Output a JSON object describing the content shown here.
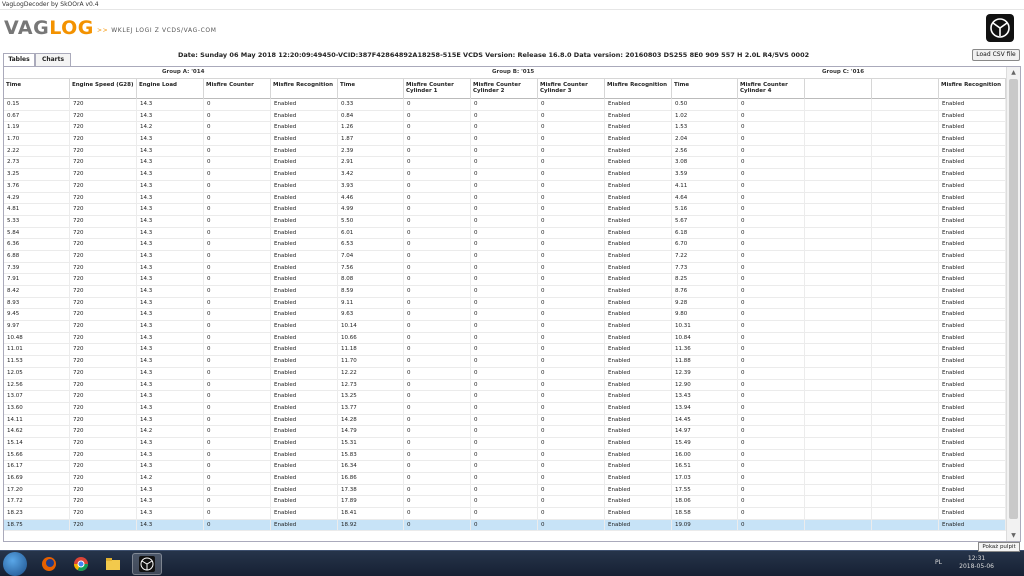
{
  "window": {
    "title": "VagLogDecoder by SkOOrA v0.4"
  },
  "logo": {
    "text_main": "VAG",
    "text_accent": "LOG",
    "arrows": ">>",
    "subtitle": "WKLEJ LOGI Z VCDS/VAG-COM"
  },
  "tabs": [
    {
      "label": "Tables",
      "active": true
    },
    {
      "label": "Charts",
      "active": false
    }
  ],
  "info": "Date: Sunday 06 May 2018 12:20:09:49450-VCID:387F42864892A18258-515E VCDS Version: Release 16.8.0 Data version: 20160803 DS255 8E0 909 557 H  2.0L R4/5VS       0002",
  "load_button": "Load CSV file",
  "groups": [
    "Group A: '014",
    "Group B: '015",
    "Group C: '016"
  ],
  "columns": [
    "Time",
    "Engine Speed (G28)",
    "Engine Load",
    "Misfire Counter",
    "Misfire Recognition",
    "Time",
    "Misfire Counter Cylinder 1",
    "Misfire Counter Cylinder 2",
    "Misfire Counter Cylinder 3",
    "Misfire Recognition",
    "Time",
    "Misfire Counter Cylinder 4",
    "",
    "",
    "Misfire Recognition"
  ],
  "rows": [
    [
      "0.15",
      "720",
      "14.3",
      "0",
      "Enabled",
      "0.33",
      "0",
      "0",
      "0",
      "Enabled",
      "0.50",
      "0",
      "",
      "",
      "Enabled"
    ],
    [
      "0.67",
      "720",
      "14.3",
      "0",
      "Enabled",
      "0.84",
      "0",
      "0",
      "0",
      "Enabled",
      "1.02",
      "0",
      "",
      "",
      "Enabled"
    ],
    [
      "1.19",
      "720",
      "14.2",
      "0",
      "Enabled",
      "1.26",
      "0",
      "0",
      "0",
      "Enabled",
      "1.53",
      "0",
      "",
      "",
      "Enabled"
    ],
    [
      "1.70",
      "720",
      "14.3",
      "0",
      "Enabled",
      "1.87",
      "0",
      "0",
      "0",
      "Enabled",
      "2.04",
      "0",
      "",
      "",
      "Enabled"
    ],
    [
      "2.22",
      "720",
      "14.3",
      "0",
      "Enabled",
      "2.39",
      "0",
      "0",
      "0",
      "Enabled",
      "2.56",
      "0",
      "",
      "",
      "Enabled"
    ],
    [
      "2.73",
      "720",
      "14.3",
      "0",
      "Enabled",
      "2.91",
      "0",
      "0",
      "0",
      "Enabled",
      "3.08",
      "0",
      "",
      "",
      "Enabled"
    ],
    [
      "3.25",
      "720",
      "14.3",
      "0",
      "Enabled",
      "3.42",
      "0",
      "0",
      "0",
      "Enabled",
      "3.59",
      "0",
      "",
      "",
      "Enabled"
    ],
    [
      "3.76",
      "720",
      "14.3",
      "0",
      "Enabled",
      "3.93",
      "0",
      "0",
      "0",
      "Enabled",
      "4.11",
      "0",
      "",
      "",
      "Enabled"
    ],
    [
      "4.29",
      "720",
      "14.3",
      "0",
      "Enabled",
      "4.46",
      "0",
      "0",
      "0",
      "Enabled",
      "4.64",
      "0",
      "",
      "",
      "Enabled"
    ],
    [
      "4.81",
      "720",
      "14.3",
      "0",
      "Enabled",
      "4.99",
      "0",
      "0",
      "0",
      "Enabled",
      "5.16",
      "0",
      "",
      "",
      "Enabled"
    ],
    [
      "5.33",
      "720",
      "14.3",
      "0",
      "Enabled",
      "5.50",
      "0",
      "0",
      "0",
      "Enabled",
      "5.67",
      "0",
      "",
      "",
      "Enabled"
    ],
    [
      "5.84",
      "720",
      "14.3",
      "0",
      "Enabled",
      "6.01",
      "0",
      "0",
      "0",
      "Enabled",
      "6.18",
      "0",
      "",
      "",
      "Enabled"
    ],
    [
      "6.36",
      "720",
      "14.3",
      "0",
      "Enabled",
      "6.53",
      "0",
      "0",
      "0",
      "Enabled",
      "6.70",
      "0",
      "",
      "",
      "Enabled"
    ],
    [
      "6.88",
      "720",
      "14.3",
      "0",
      "Enabled",
      "7.04",
      "0",
      "0",
      "0",
      "Enabled",
      "7.22",
      "0",
      "",
      "",
      "Enabled"
    ],
    [
      "7.39",
      "720",
      "14.3",
      "0",
      "Enabled",
      "7.56",
      "0",
      "0",
      "0",
      "Enabled",
      "7.73",
      "0",
      "",
      "",
      "Enabled"
    ],
    [
      "7.91",
      "720",
      "14.3",
      "0",
      "Enabled",
      "8.08",
      "0",
      "0",
      "0",
      "Enabled",
      "8.25",
      "0",
      "",
      "",
      "Enabled"
    ],
    [
      "8.42",
      "720",
      "14.3",
      "0",
      "Enabled",
      "8.59",
      "0",
      "0",
      "0",
      "Enabled",
      "8.76",
      "0",
      "",
      "",
      "Enabled"
    ],
    [
      "8.93",
      "720",
      "14.3",
      "0",
      "Enabled",
      "9.11",
      "0",
      "0",
      "0",
      "Enabled",
      "9.28",
      "0",
      "",
      "",
      "Enabled"
    ],
    [
      "9.45",
      "720",
      "14.3",
      "0",
      "Enabled",
      "9.63",
      "0",
      "0",
      "0",
      "Enabled",
      "9.80",
      "0",
      "",
      "",
      "Enabled"
    ],
    [
      "9.97",
      "720",
      "14.3",
      "0",
      "Enabled",
      "10.14",
      "0",
      "0",
      "0",
      "Enabled",
      "10.31",
      "0",
      "",
      "",
      "Enabled"
    ],
    [
      "10.48",
      "720",
      "14.3",
      "0",
      "Enabled",
      "10.66",
      "0",
      "0",
      "0",
      "Enabled",
      "10.84",
      "0",
      "",
      "",
      "Enabled"
    ],
    [
      "11.01",
      "720",
      "14.3",
      "0",
      "Enabled",
      "11.18",
      "0",
      "0",
      "0",
      "Enabled",
      "11.36",
      "0",
      "",
      "",
      "Enabled"
    ],
    [
      "11.53",
      "720",
      "14.3",
      "0",
      "Enabled",
      "11.70",
      "0",
      "0",
      "0",
      "Enabled",
      "11.88",
      "0",
      "",
      "",
      "Enabled"
    ],
    [
      "12.05",
      "720",
      "14.3",
      "0",
      "Enabled",
      "12.22",
      "0",
      "0",
      "0",
      "Enabled",
      "12.39",
      "0",
      "",
      "",
      "Enabled"
    ],
    [
      "12.56",
      "720",
      "14.3",
      "0",
      "Enabled",
      "12.73",
      "0",
      "0",
      "0",
      "Enabled",
      "12.90",
      "0",
      "",
      "",
      "Enabled"
    ],
    [
      "13.07",
      "720",
      "14.3",
      "0",
      "Enabled",
      "13.25",
      "0",
      "0",
      "0",
      "Enabled",
      "13.43",
      "0",
      "",
      "",
      "Enabled"
    ],
    [
      "13.60",
      "720",
      "14.3",
      "0",
      "Enabled",
      "13.77",
      "0",
      "0",
      "0",
      "Enabled",
      "13.94",
      "0",
      "",
      "",
      "Enabled"
    ],
    [
      "14.11",
      "720",
      "14.3",
      "0",
      "Enabled",
      "14.28",
      "0",
      "0",
      "0",
      "Enabled",
      "14.45",
      "0",
      "",
      "",
      "Enabled"
    ],
    [
      "14.62",
      "720",
      "14.2",
      "0",
      "Enabled",
      "14.79",
      "0",
      "0",
      "0",
      "Enabled",
      "14.97",
      "0",
      "",
      "",
      "Enabled"
    ],
    [
      "15.14",
      "720",
      "14.3",
      "0",
      "Enabled",
      "15.31",
      "0",
      "0",
      "0",
      "Enabled",
      "15.49",
      "0",
      "",
      "",
      "Enabled"
    ],
    [
      "15.66",
      "720",
      "14.3",
      "0",
      "Enabled",
      "15.83",
      "0",
      "0",
      "0",
      "Enabled",
      "16.00",
      "0",
      "",
      "",
      "Enabled"
    ],
    [
      "16.17",
      "720",
      "14.3",
      "0",
      "Enabled",
      "16.34",
      "0",
      "0",
      "0",
      "Enabled",
      "16.51",
      "0",
      "",
      "",
      "Enabled"
    ],
    [
      "16.69",
      "720",
      "14.2",
      "0",
      "Enabled",
      "16.86",
      "0",
      "0",
      "0",
      "Enabled",
      "17.03",
      "0",
      "",
      "",
      "Enabled"
    ],
    [
      "17.20",
      "720",
      "14.3",
      "0",
      "Enabled",
      "17.38",
      "0",
      "0",
      "0",
      "Enabled",
      "17.55",
      "0",
      "",
      "",
      "Enabled"
    ],
    [
      "17.72",
      "720",
      "14.3",
      "0",
      "Enabled",
      "17.89",
      "0",
      "0",
      "0",
      "Enabled",
      "18.06",
      "0",
      "",
      "",
      "Enabled"
    ],
    [
      "18.23",
      "720",
      "14.3",
      "0",
      "Enabled",
      "18.41",
      "0",
      "0",
      "0",
      "Enabled",
      "18.58",
      "0",
      "",
      "",
      "Enabled"
    ],
    [
      "18.75",
      "720",
      "14.3",
      "0",
      "Enabled",
      "18.92",
      "0",
      "0",
      "0",
      "Enabled",
      "19.09",
      "0",
      "",
      "",
      "Enabled"
    ]
  ],
  "selected_row": 36,
  "taskbar": {
    "lang": "PL",
    "time": "12:31",
    "date": "2018-05-06",
    "tooltip": "Pokaż pulpit"
  },
  "colors": {
    "accent": "#f39200",
    "selection": "#c7e3f7",
    "taskbar": "#1d2a40"
  }
}
